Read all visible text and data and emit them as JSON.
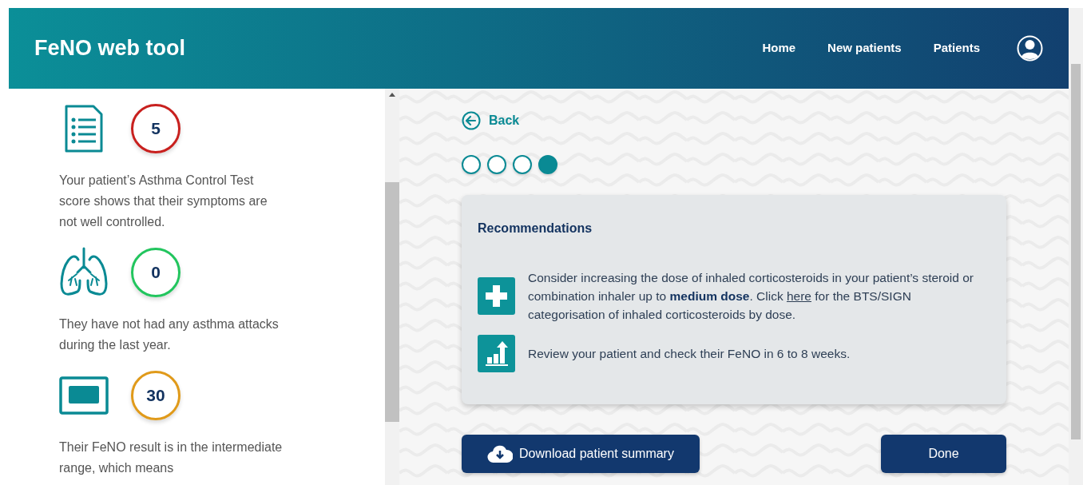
{
  "header": {
    "title": "FeNO web tool",
    "nav": [
      {
        "label": "Home"
      },
      {
        "label": "New patients"
      },
      {
        "label": "Patients"
      }
    ]
  },
  "summary": [
    {
      "kind": "document",
      "score": "5",
      "color": "#c8201e",
      "text": "Your patient’s Asthma Control Test score shows that their symptoms are not well controlled."
    },
    {
      "kind": "lungs",
      "score": "0",
      "color": "#22c55e",
      "text": "They have not had any asthma attacks during the last year."
    },
    {
      "kind": "monitor",
      "score": "30",
      "color": "#e09a1a",
      "text": "Their FeNO result is in the intermediate range, which means"
    }
  ],
  "back": {
    "label": "Back"
  },
  "steps": [
    {
      "selected": false
    },
    {
      "selected": false
    },
    {
      "selected": false
    },
    {
      "selected": true
    }
  ],
  "recommendations": {
    "title": "Recommendations",
    "items": [
      {
        "kind": "plus",
        "text": "Consider increasing the dose of inhaled corticosteroids in your patient’s steroid or combination inhaler up to **medium dose**. Click",
        "link": "here",
        "text_after": "for the BTS/SIGN categorisation of inhaled corticosteroids by dose."
      },
      {
        "kind": "chart",
        "text": "Review your patient and check their FeNO in 6 to 8 weeks."
      }
    ]
  },
  "buttons": {
    "download": "Download patient summary",
    "done": "Done"
  }
}
